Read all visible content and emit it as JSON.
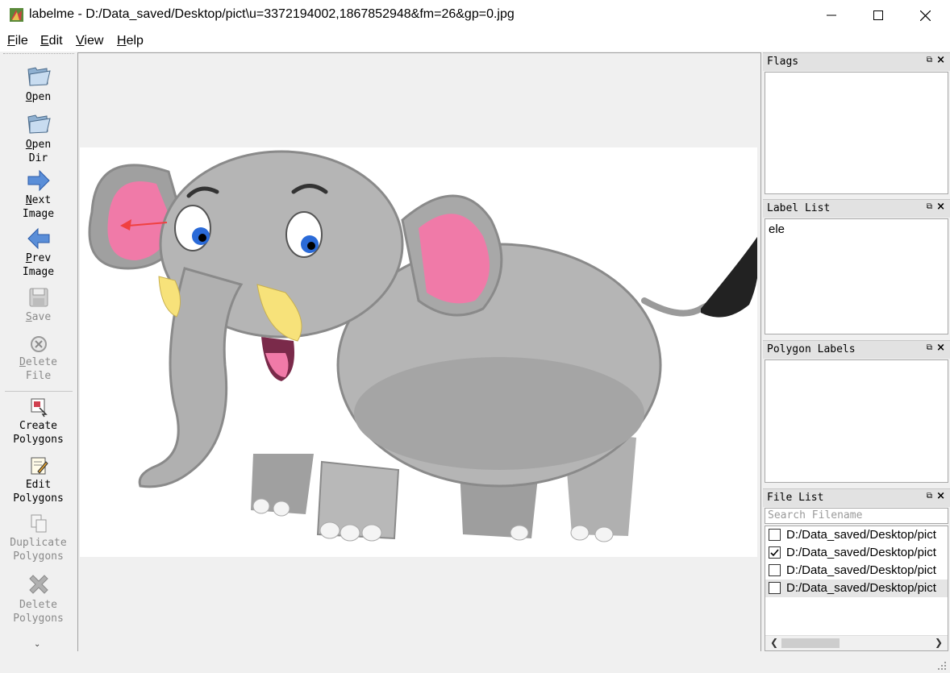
{
  "window": {
    "title": "labelme - D:/Data_saved/Desktop/pict\\u=3372194002,1867852948&fm=26&gp=0.jpg"
  },
  "menu": [
    "File",
    "Edit",
    "View",
    "Help"
  ],
  "toolbar": {
    "open": "Open",
    "open_dir": "Open\nDir",
    "next_image": "Next\nImage",
    "prev_image": "Prev\nImage",
    "save": "Save",
    "delete_file": "Delete\nFile",
    "create_polygons": "Create\nPolygons",
    "edit_polygons": "Edit\nPolygons",
    "duplicate_polygons": "Duplicate\nPolygons",
    "delete_polygons": "Delete\nPolygons"
  },
  "docks": {
    "flags": {
      "title": "Flags"
    },
    "label_list": {
      "title": "Label List",
      "items": [
        "ele"
      ]
    },
    "polygon_labels": {
      "title": "Polygon Labels"
    },
    "file_list": {
      "title": "File List",
      "search_placeholder": "Search Filename",
      "files": [
        {
          "name": "D:/Data_saved/Desktop/pict",
          "checked": false
        },
        {
          "name": "D:/Data_saved/Desktop/pict",
          "checked": true
        },
        {
          "name": "D:/Data_saved/Desktop/pict",
          "checked": false
        },
        {
          "name": "D:/Data_saved/Desktop/pict",
          "checked": false
        }
      ]
    }
  },
  "colors": {
    "annotation_arrow": "#f04040",
    "elephant_body": "#a8a8a8",
    "elephant_ear": "#f07aa8"
  }
}
